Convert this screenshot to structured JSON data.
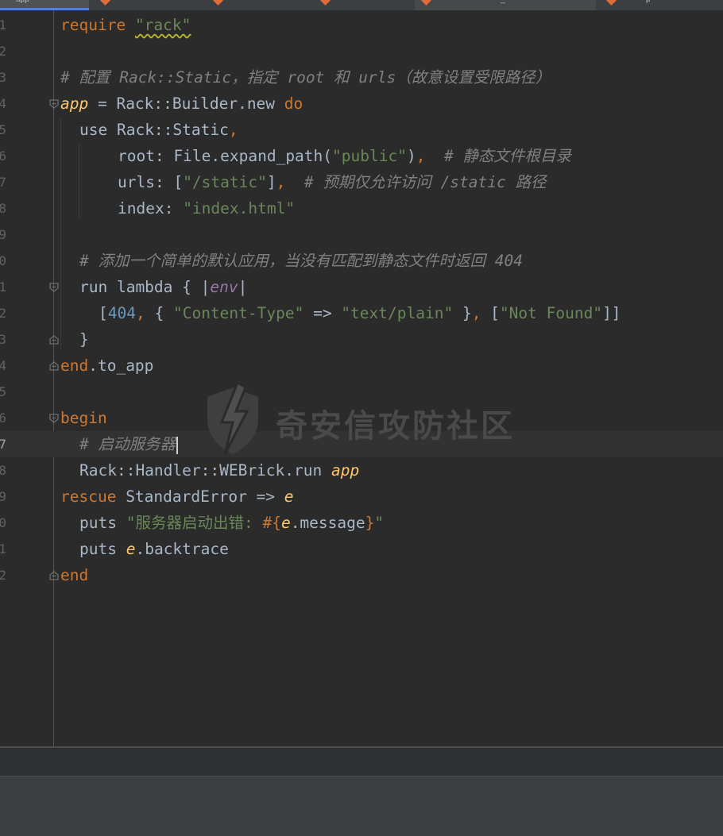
{
  "tabs": [
    {
      "label": "app"
    },
    {
      "label": ""
    },
    {
      "label": ""
    },
    {
      "label": ""
    },
    {
      "label": "_"
    },
    {
      "label": "p"
    }
  ],
  "code": {
    "line1": {
      "ln": "1",
      "t1": "require",
      "t2": " ",
      "t3": "\"rack\""
    },
    "line2": {
      "ln": "2"
    },
    "line3": {
      "ln": "3",
      "t1": "# 配置 Rack::Static，指定 root 和 urls（故意设置受限路径）"
    },
    "line4": {
      "ln": "4",
      "t1": "app",
      "t2": " = Rack::Builder.new ",
      "t3": "do"
    },
    "line5": {
      "ln": "5",
      "t1": "use",
      "t2": " Rack::Static",
      "t3": ","
    },
    "line6": {
      "ln": "6",
      "t1": "root: File.expand_path(",
      "t2": "\"public\"",
      "t3": ")",
      "t4": ",  ",
      "t5": "# 静态文件根目录"
    },
    "line7": {
      "ln": "7",
      "t1": "urls: [",
      "t2": "\"/static\"",
      "t3": "]",
      "t4": ",  ",
      "t5": "# 预期仅允许访问 /static 路径"
    },
    "line8": {
      "ln": "8",
      "t1": "index: ",
      "t2": "\"index.html\""
    },
    "line9": {
      "ln": "9"
    },
    "line10": {
      "ln": "0",
      "t1": "# 添加一个简单的默认应用，当没有匹配到静态文件时返回 404"
    },
    "line11": {
      "ln": "1",
      "t1": "run lambda { |",
      "t2": "env",
      "t3": "|"
    },
    "line12": {
      "ln": "2",
      "t1": "[",
      "t2": "404",
      "t3": ",",
      "t4": " { ",
      "t5": "\"Content-Type\"",
      "t6": " => ",
      "t7": "\"text/plain\"",
      "t8": " }",
      "t9": ",",
      "t10": " [",
      "t11": "\"Not Found\"",
      "t12": "]]"
    },
    "line13": {
      "ln": "3",
      "t1": "}"
    },
    "line14": {
      "ln": "4",
      "t1": "end",
      "t2": ".to_app"
    },
    "line15": {
      "ln": "5"
    },
    "line16": {
      "ln": "6",
      "t1": "begin"
    },
    "line17": {
      "ln": "7",
      "t1": "# 启动服务器"
    },
    "line18": {
      "ln": "8",
      "t1": "Rack::Handler::WEBrick.run ",
      "t2": "app"
    },
    "line19": {
      "ln": "9",
      "t1": "rescue",
      "t2": " StandardError => ",
      "t3": "e"
    },
    "line20": {
      "ln": "0",
      "t1": "puts",
      "t2": " ",
      "t3": "\"服务器启动出错: ",
      "t4": "#{",
      "t5": "e",
      "t6": ".message",
      "t7": "}",
      "t8": "\""
    },
    "line21": {
      "ln": "1",
      "t1": "puts",
      "t2": " ",
      "t3": "e",
      "t4": ".backtrace"
    },
    "line22": {
      "ln": "2",
      "t1": "end"
    }
  },
  "watermark": {
    "text": "奇安信攻防社区"
  },
  "colors": {
    "background": "#2b2b2b",
    "keyword": "#cc7832",
    "string": "#6a8759",
    "comment": "#808080",
    "number": "#6897bb",
    "identifier": "#a9b7c6",
    "local_variable": "#ffc66d",
    "tab_underline": "#4a88c7"
  },
  "icons": [
    "ruby-file-icon",
    "fold-marker-icon",
    "shield-lightning-logo-icon"
  ]
}
